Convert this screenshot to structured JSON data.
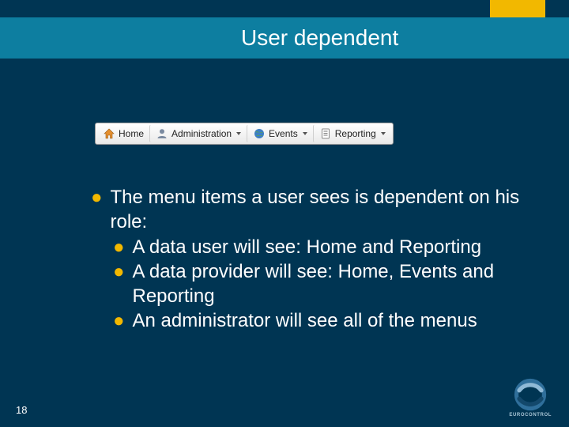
{
  "header": {
    "title": "User dependent"
  },
  "toolbar": {
    "items": [
      {
        "label": "Home",
        "icon": "home-icon",
        "dropdown": false
      },
      {
        "label": "Administration",
        "icon": "user-icon",
        "dropdown": true
      },
      {
        "label": "Events",
        "icon": "globe-icon",
        "dropdown": true
      },
      {
        "label": "Reporting",
        "icon": "document-icon",
        "dropdown": true
      }
    ]
  },
  "content": {
    "bullet_main": "The menu items a user sees is dependent on his role:",
    "sub_bullets": [
      "A data user will see: Home and Reporting",
      "A data provider will see: Home, Events and Reporting",
      "An administrator will see all of the menus"
    ]
  },
  "footer": {
    "slide_number": "18",
    "logo_text": "EUROCONTROL"
  }
}
